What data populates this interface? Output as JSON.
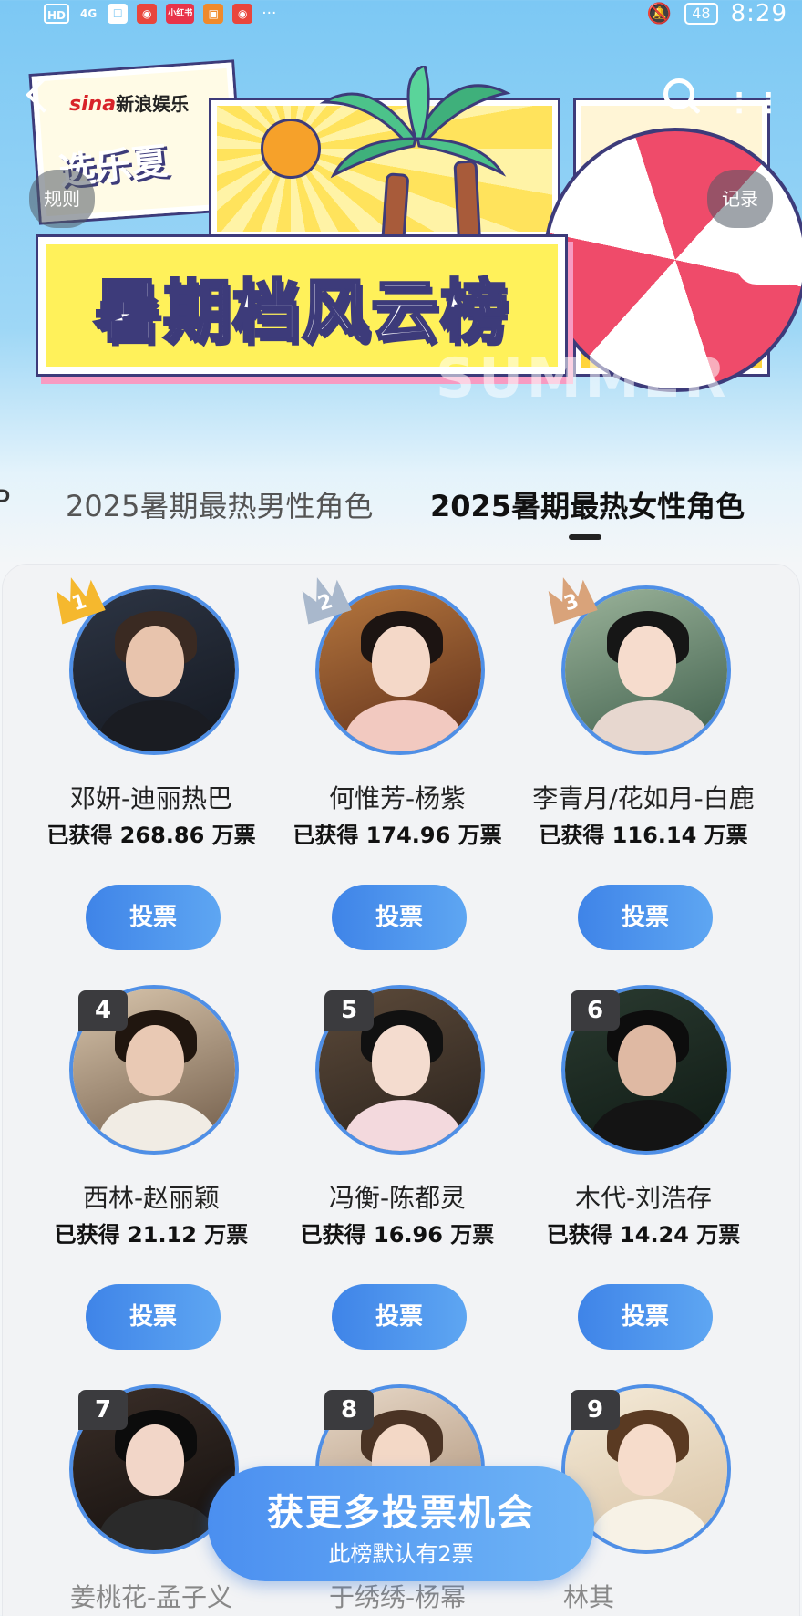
{
  "status_bar": {
    "left_items": [
      "HD",
      "4G",
      "微",
      "小红书",
      "支",
      "微"
    ],
    "battery": "48",
    "time": "8:29"
  },
  "header": {
    "brand": "sina",
    "brand_text": "新浪娱乐",
    "event_logo": "选乐夏",
    "title": "暑期档风云榜",
    "watermark": "SUMMER",
    "rules_label": "规则",
    "record_label": "记录"
  },
  "tabs": [
    {
      "label": "P",
      "active": false
    },
    {
      "label": "2025暑期最热男性角色",
      "active": false
    },
    {
      "label": "2025暑期最热女性角色",
      "active": true
    }
  ],
  "candidates": [
    {
      "rank": "1",
      "name": "邓妍-迪丽热巴",
      "votes": "已获得 268.86 万票",
      "vote_label": "投票",
      "crown": "gold"
    },
    {
      "rank": "2",
      "name": "何惟芳-杨紫",
      "votes": "已获得 174.96 万票",
      "vote_label": "投票",
      "crown": "silver"
    },
    {
      "rank": "3",
      "name": "李青月/花如月-白鹿",
      "votes": "已获得 116.14 万票",
      "vote_label": "投票",
      "crown": "bronze"
    },
    {
      "rank": "4",
      "name": "西林-赵丽颖",
      "votes": "已获得 21.12 万票",
      "vote_label": "投票"
    },
    {
      "rank": "5",
      "name": "冯衡-陈都灵",
      "votes": "已获得 16.96 万票",
      "vote_label": "投票"
    },
    {
      "rank": "6",
      "name": "木代-刘浩存",
      "votes": "已获得 14.24 万票",
      "vote_label": "投票"
    },
    {
      "rank": "7",
      "name": "姜桃花-孟子义",
      "votes": "",
      "vote_label": ""
    },
    {
      "rank": "8",
      "name": "于绣绣-杨幂",
      "votes": "",
      "vote_label": ""
    },
    {
      "rank": "9",
      "name": "林其",
      "votes": "",
      "vote_label": ""
    }
  ],
  "cta": {
    "title": "获更多投票机会",
    "subtitle": "此榜默认有2票"
  },
  "colors": {
    "accent": "#4f8fe6",
    "button": "#3f84e8",
    "gold": "#f5b82e",
    "silver": "#a9b8cc",
    "bronze": "#d9a37a",
    "rank_badge": "#3b3b3e"
  }
}
